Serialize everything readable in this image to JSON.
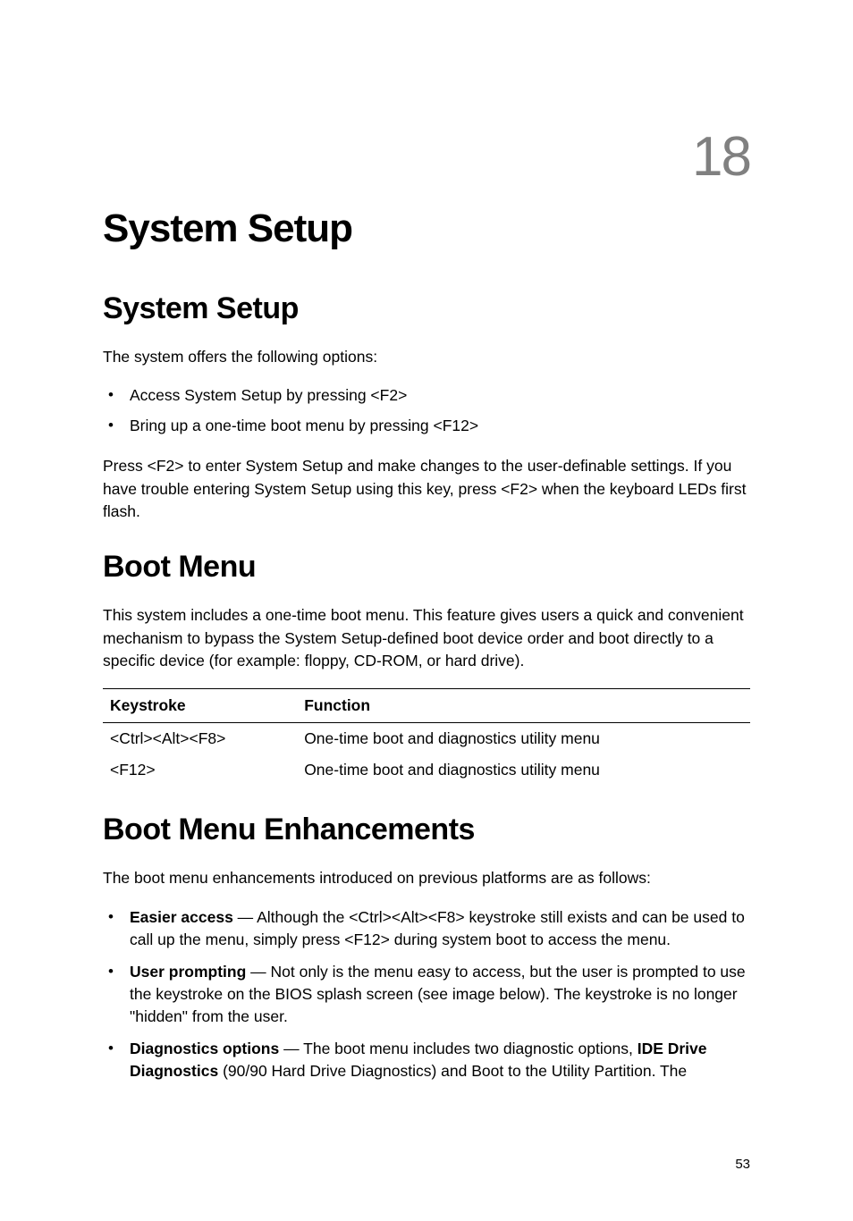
{
  "chapter": {
    "number": "18",
    "title": "System Setup"
  },
  "sections": {
    "system_setup": {
      "title": "System Setup",
      "intro": "The system offers the following options:",
      "bullets": {
        "b1": "Access System Setup by pressing <F2>",
        "b2": "Bring up a one-time boot menu by pressing <F12>"
      },
      "para": "Press <F2> to enter System Setup and make changes to the user-definable settings. If you have trouble entering System Setup using this key, press <F2> when the keyboard LEDs first flash."
    },
    "boot_menu": {
      "title": "Boot Menu",
      "intro": "This system includes a one-time boot menu. This feature gives users a quick and convenient mechanism to bypass the System Setup-defined boot device order and boot directly to a specific device (for example: floppy, CD-ROM, or hard drive).",
      "table": {
        "header": {
          "keystroke": "Keystroke",
          "function": "Function"
        },
        "rows": {
          "r1": {
            "keystroke": "<Ctrl><Alt><F8>",
            "function": "One-time boot and diagnostics utility menu"
          },
          "r2": {
            "keystroke": "<F12>",
            "function": "One-time boot and diagnostics utility menu"
          }
        }
      }
    },
    "boot_menu_enh": {
      "title": "Boot Menu Enhancements",
      "intro": "The boot menu enhancements introduced on previous platforms are as follows:",
      "items": {
        "i1": {
          "label": "Easier access",
          "text": " — Although the <Ctrl><Alt><F8> keystroke still exists and can be used to call up the menu, simply press <F12> during system boot to access the menu."
        },
        "i2": {
          "label": "User prompting",
          "text": " — Not only is the menu easy to access, but the user is prompted to use the keystroke on the BIOS splash screen (see image below). The keystroke is no longer \"hidden\" from the user."
        },
        "i3": {
          "label": "Diagnostics options",
          "text_before_bold2": " — The boot menu includes two diagnostic options, ",
          "bold2": "IDE Drive Diagnostics",
          "text_after_bold2": " (90/90 Hard Drive Diagnostics) and Boot to the Utility Partition. The"
        }
      }
    }
  },
  "page_number": "53"
}
